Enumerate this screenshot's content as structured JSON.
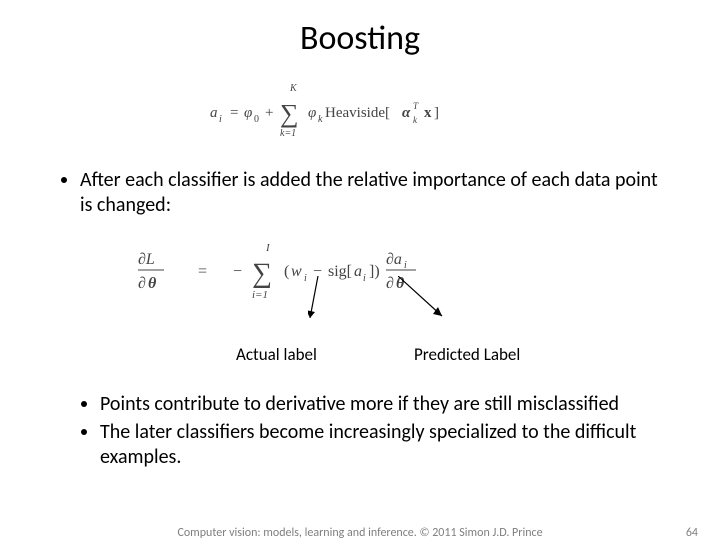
{
  "title": "Boosting",
  "bullet1": "After each classifier is added the relative importance of each data point is changed:",
  "labels": {
    "actual": "Actual label",
    "predicted": "Predicted Label"
  },
  "sub_bullets": [
    "Points contribute to derivative more if they are still misclassified",
    "The later classifiers become increasingly specialized to the difficult examples."
  ],
  "footer": {
    "credit": "Computer vision: models, learning and inference.   © 2011 Simon J.D. Prince",
    "page": "64"
  },
  "eq1": {
    "lhs": "a_i = \\phi_0 + \\sum_{k=1}^{K} \\phi_k Heaviside[\\alpha_k^T x]"
  },
  "eq2": {
    "lhs": "\\partial L / \\partial\\theta = -\\sum_{i=1}^{I} (w_i - sig[a_i]) \\partial a_i / \\partial\\theta"
  }
}
